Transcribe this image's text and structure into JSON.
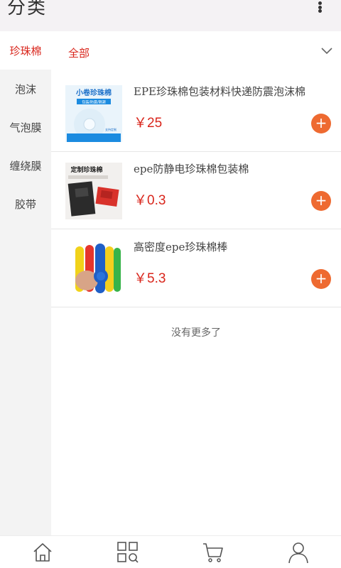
{
  "header": {
    "title": "分类"
  },
  "sidebar": {
    "items": [
      {
        "label": "珍珠棉",
        "active": true
      },
      {
        "label": "泡沫",
        "active": false
      },
      {
        "label": "气泡膜",
        "active": false
      },
      {
        "label": "缠绕膜",
        "active": false
      },
      {
        "label": "胶带",
        "active": false
      }
    ]
  },
  "category_bar": {
    "label": "全部",
    "icon": "chevron-down-icon"
  },
  "products": [
    {
      "name": "EPE珍珠棉包装材料快递防震泡沫棉",
      "price": "￥25",
      "image_text": [
        "小卷珍珠棉",
        "包装/防震/隔潮",
        "支持定制"
      ]
    },
    {
      "name": "epe防静电珍珠棉包装棉",
      "price": "￥0.3",
      "image_text": [
        "定制珍珠棉"
      ]
    },
    {
      "name": "高密度epe珍珠棉棒",
      "price": "￥5.3",
      "image_text": []
    }
  ],
  "footer_note": "没有更多了",
  "tabbar": {
    "icons": [
      "home-icon",
      "category-search-icon",
      "cart-icon",
      "user-icon"
    ]
  },
  "colors": {
    "accent_red": "#d9261c",
    "add_button": "#ee6a31",
    "sidebar_bg": "#f3f3f3"
  }
}
